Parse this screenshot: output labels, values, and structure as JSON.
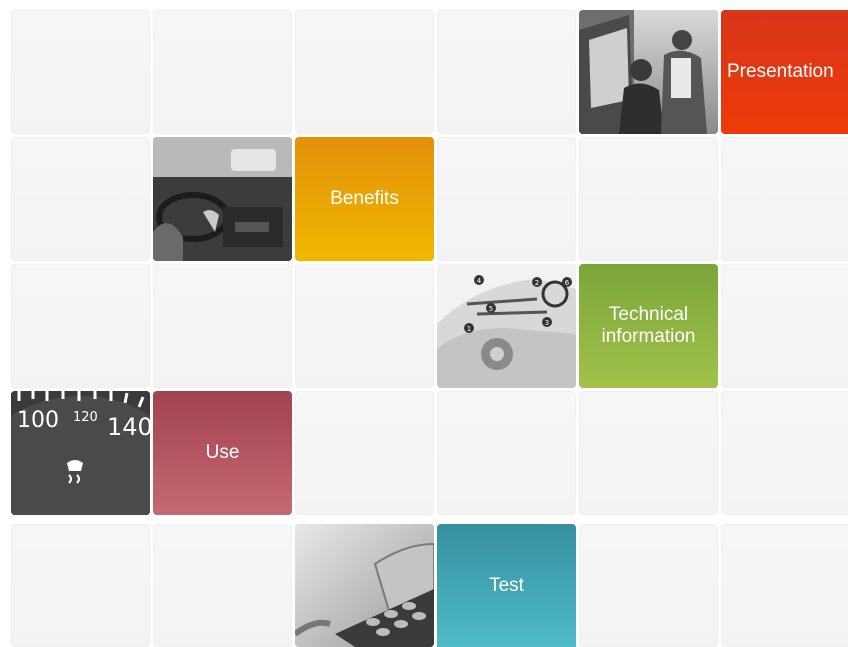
{
  "menu": {
    "presentation": {
      "label": "Presentation",
      "color": "#e03a10"
    },
    "benefits": {
      "label": "Benefits",
      "color": "#e8a300"
    },
    "technical": {
      "label": "Technical\ninformation",
      "color": "#8fb540"
    },
    "use": {
      "label": "Use",
      "color": "#b95562"
    },
    "test": {
      "label": "Test",
      "color": "#3fa7b8"
    }
  },
  "speedometer": {
    "ticks": [
      "100",
      "120",
      "140"
    ]
  },
  "diagram": {
    "callouts": [
      "1",
      "2",
      "3",
      "4",
      "5",
      "6"
    ]
  },
  "icons": [
    "car-dealer-photo",
    "driver-photo",
    "car-diagram-photo",
    "speedometer-photo",
    "phone-photo"
  ]
}
